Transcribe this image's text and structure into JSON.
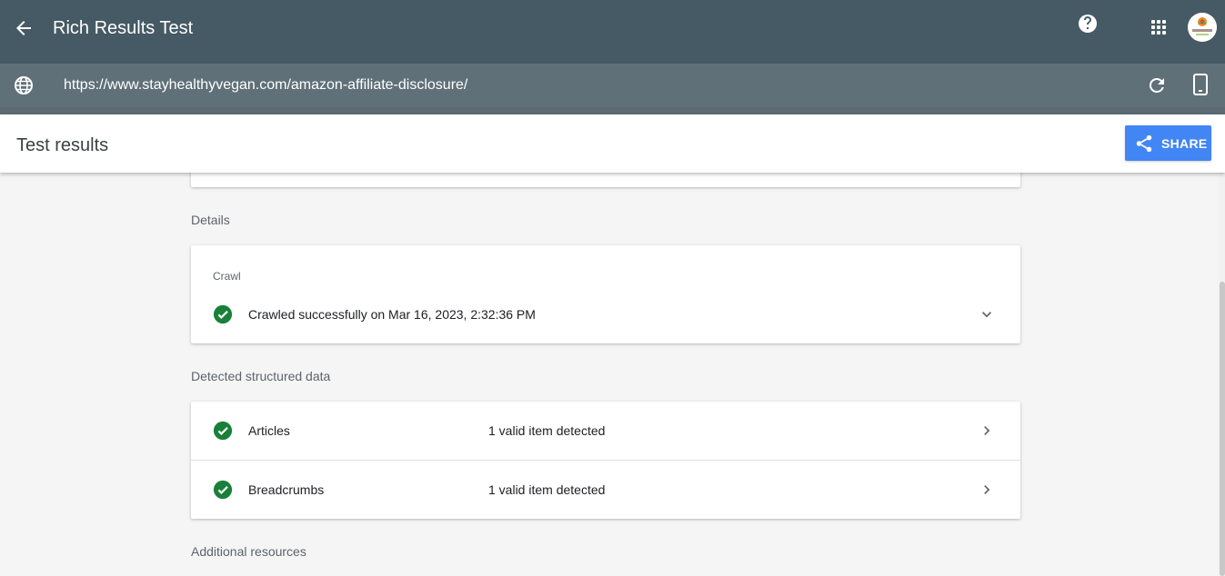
{
  "appbar": {
    "title": "Rich Results Test",
    "back_icon": "arrow-back-icon",
    "help_icon": "help-icon",
    "apps_icon": "apps-grid-icon",
    "avatar_text": "stayhealthy"
  },
  "urlbar": {
    "url": "https://www.stayhealthyvegan.com/amazon-affiliate-disclosure/",
    "globe_icon": "globe-icon",
    "reload_icon": "reload-icon",
    "device_icon": "smartphone-icon"
  },
  "results": {
    "title": "Test results",
    "share_label": "SHARE"
  },
  "details": {
    "label": "Details",
    "crawl": {
      "label": "Crawl",
      "status": "Crawled successfully on Mar 16, 2023, 2:32:36 PM"
    }
  },
  "structured": {
    "label": "Detected structured data",
    "items": [
      {
        "name": "Articles",
        "status": "1 valid item detected"
      },
      {
        "name": "Breadcrumbs",
        "status": "1 valid item detected"
      }
    ]
  },
  "additional": {
    "label": "Additional resources"
  },
  "colors": {
    "appbar": "#455a64",
    "urlbar": "#607079",
    "accent": "#4285f4",
    "success": "#188038"
  }
}
